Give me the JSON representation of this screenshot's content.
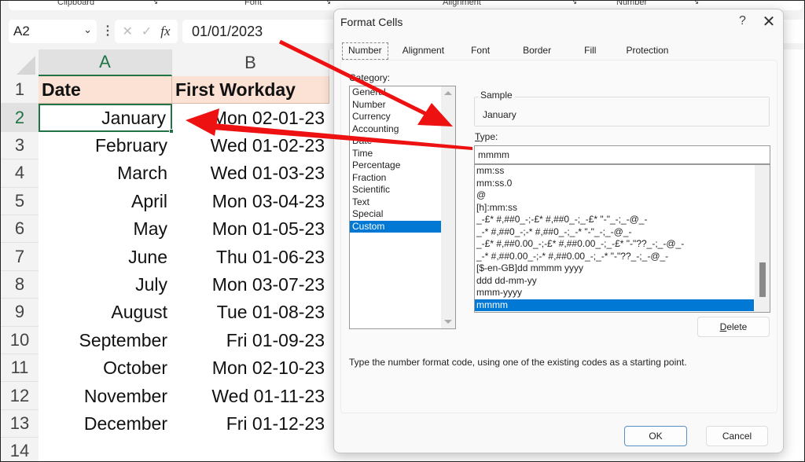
{
  "ribbon": {
    "groups": [
      "Clipboard",
      "Font",
      "Alignment",
      "Number"
    ]
  },
  "formula_bar": {
    "name_box": "A2",
    "cancel_icon": "✕",
    "enter_icon": "✓",
    "fx_label": "fx",
    "formula": "01/01/2023"
  },
  "sheet": {
    "columns": [
      "A",
      "B"
    ],
    "row_numbers": [
      "1",
      "2",
      "3",
      "4",
      "5",
      "6",
      "7",
      "8",
      "9",
      "10",
      "11",
      "12",
      "13",
      "14"
    ],
    "header": {
      "date": "Date",
      "first_workday": "First Workday"
    },
    "rows": [
      {
        "date": "January",
        "first_workday": "Mon 02-01-23"
      },
      {
        "date": "February",
        "first_workday": "Wed 01-02-23"
      },
      {
        "date": "March",
        "first_workday": "Wed 01-03-23"
      },
      {
        "date": "April",
        "first_workday": "Mon 03-04-23"
      },
      {
        "date": "May",
        "first_workday": "Mon 01-05-23"
      },
      {
        "date": "June",
        "first_workday": "Thu 01-06-23"
      },
      {
        "date": "July",
        "first_workday": "Mon 03-07-23"
      },
      {
        "date": "August",
        "first_workday": "Tue 01-08-23"
      },
      {
        "date": "September",
        "first_workday": "Fri 01-09-23"
      },
      {
        "date": "October",
        "first_workday": "Mon 02-10-23"
      },
      {
        "date": "November",
        "first_workday": "Wed 01-11-23"
      },
      {
        "date": "December",
        "first_workday": "Fri 01-12-23"
      }
    ],
    "active_cell": "A2",
    "colors": {
      "header_fill": "#fbe2d5",
      "selection_green": "#217346"
    }
  },
  "dialog": {
    "title": "Format Cells",
    "help": "?",
    "close": "✕",
    "tabs": [
      "Number",
      "Alignment",
      "Font",
      "Border",
      "Fill",
      "Protection"
    ],
    "active_tab": "Number",
    "category_label": "Category:",
    "categories": [
      "General",
      "Number",
      "Currency",
      "Accounting",
      "Date",
      "Time",
      "Percentage",
      "Fraction",
      "Scientific",
      "Text",
      "Special",
      "Custom"
    ],
    "selected_category": "Custom",
    "sample_label": "Sample",
    "sample_value": "January",
    "type_label": "Type:",
    "type_value": "mmmm",
    "type_list": [
      "mm:ss",
      "mm:ss.0",
      "@",
      "[h]:mm:ss",
      "_-£* #,##0_-;-£* #,##0_-;_-£* \"-\"_-;_-@_-",
      "_-* #,##0_-;-* #,##0_-;_-* \"-\"_-;_-@_-",
      "_-£* #,##0.00_-;-£* #,##0.00_-;_-£* \"-\"??_-;_-@_-",
      "_-* #,##0.00_-;-* #,##0.00_-;_-* \"-\"??_-;_-@_-",
      "[$-en-GB]dd mmmm yyyy",
      "ddd dd-mm-yy",
      "mmm-yyyy",
      "mmmm"
    ],
    "selected_type": "mmmm",
    "delete_label": "Delete",
    "hint": "Type the number format code, using one of the existing codes as a starting point.",
    "ok_label": "OK",
    "cancel_label": "Cancel",
    "accent": "#0078d4"
  },
  "annotations": {
    "arrow_color": "#ee1111"
  }
}
